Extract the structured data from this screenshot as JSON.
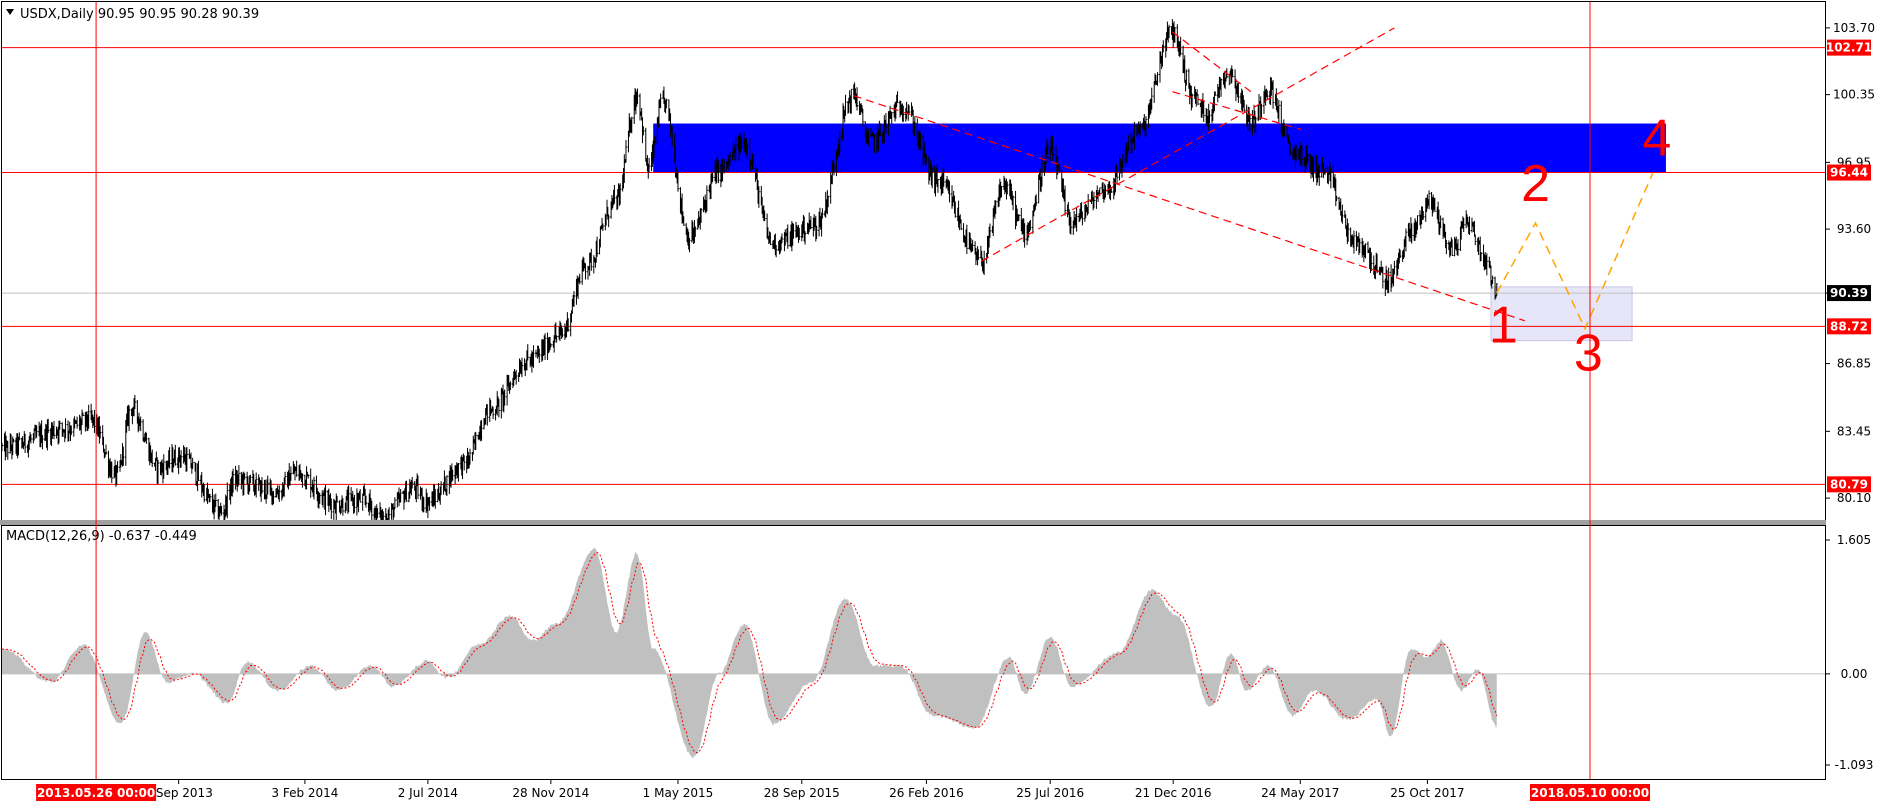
{
  "chart_data": [
    {
      "type": "candlestick",
      "header": "USDX,Daily  90.95 90.95 90.28 90.39",
      "price_axis": {
        "ticks": [
          "103.70",
          "100.35",
          "96.95",
          "93.60",
          "90.39",
          "86.85",
          "83.45",
          "80.10"
        ],
        "ylim": [
          79.0,
          105.0
        ]
      },
      "price_tags": [
        {
          "value": 102.71,
          "label": "102.71",
          "bg": "#ff0000",
          "fg": "#ffffff"
        },
        {
          "value": 96.44,
          "label": "96.44",
          "bg": "#ff0000",
          "fg": "#ffffff"
        },
        {
          "value": 90.39,
          "label": "90.39",
          "bg": "#000000",
          "fg": "#ffffff"
        },
        {
          "value": 88.72,
          "label": "88.72",
          "bg": "#ff0000",
          "fg": "#ffffff"
        },
        {
          "value": 80.79,
          "label": "80.79",
          "bg": "#ff0000",
          "fg": "#ffffff"
        }
      ],
      "horizontal_levels": [
        102.71,
        96.44,
        88.72,
        80.79
      ],
      "current_price": 90.39,
      "resistance_zone": {
        "from": 96.44,
        "to": 98.9,
        "color": "#0000ff"
      },
      "target_zone": {
        "from": 88.0,
        "to": 90.7,
        "color": "#e6e6f8"
      },
      "price_path_anchors": [
        {
          "date": "2013-02-01",
          "value": 82.6
        },
        {
          "date": "2013-04-20",
          "value": 83.6
        },
        {
          "date": "2013-05-20",
          "value": 84.0
        },
        {
          "date": "2013-06-20",
          "value": 81.2
        },
        {
          "date": "2013-07-08",
          "value": 84.6
        },
        {
          "date": "2013-08-10",
          "value": 81.6
        },
        {
          "date": "2013-09-05",
          "value": 82.2
        },
        {
          "date": "2013-10-25",
          "value": 79.4
        },
        {
          "date": "2013-11-10",
          "value": 81.0
        },
        {
          "date": "2014-01-01",
          "value": 80.4
        },
        {
          "date": "2014-01-22",
          "value": 81.4
        },
        {
          "date": "2014-03-12",
          "value": 79.8
        },
        {
          "date": "2014-04-15",
          "value": 80.0
        },
        {
          "date": "2014-05-08",
          "value": 79.1
        },
        {
          "date": "2014-06-15",
          "value": 80.6
        },
        {
          "date": "2014-07-01",
          "value": 79.9
        },
        {
          "date": "2014-08-15",
          "value": 81.8
        },
        {
          "date": "2014-09-15",
          "value": 84.5
        },
        {
          "date": "2014-11-01",
          "value": 87.0
        },
        {
          "date": "2014-12-10",
          "value": 88.3
        },
        {
          "date": "2015-01-10",
          "value": 91.8
        },
        {
          "date": "2015-02-15",
          "value": 95.0
        },
        {
          "date": "2015-03-13",
          "value": 100.3
        },
        {
          "date": "2015-03-26",
          "value": 96.6
        },
        {
          "date": "2015-04-13",
          "value": 100.0
        },
        {
          "date": "2015-05-15",
          "value": 93.2
        },
        {
          "date": "2015-06-20",
          "value": 96.5
        },
        {
          "date": "2015-07-20",
          "value": 97.9
        },
        {
          "date": "2015-08-24",
          "value": 92.9
        },
        {
          "date": "2015-10-15",
          "value": 93.8
        },
        {
          "date": "2015-11-30",
          "value": 100.3
        },
        {
          "date": "2015-12-20",
          "value": 98.0
        },
        {
          "date": "2016-01-28",
          "value": 99.8
        },
        {
          "date": "2016-03-10",
          "value": 96.0
        },
        {
          "date": "2016-05-03",
          "value": 92.0
        },
        {
          "date": "2016-05-30",
          "value": 95.8
        },
        {
          "date": "2016-06-24",
          "value": 93.5
        },
        {
          "date": "2016-07-25",
          "value": 97.5
        },
        {
          "date": "2016-08-20",
          "value": 94.0
        },
        {
          "date": "2016-10-01",
          "value": 95.6
        },
        {
          "date": "2016-11-10",
          "value": 98.5
        },
        {
          "date": "2016-12-20",
          "value": 103.5
        },
        {
          "date": "2017-01-15",
          "value": 100.2
        },
        {
          "date": "2017-01-31",
          "value": 99.4
        },
        {
          "date": "2017-02-25",
          "value": 101.5
        },
        {
          "date": "2017-03-27",
          "value": 99.0
        },
        {
          "date": "2017-04-15",
          "value": 100.7
        },
        {
          "date": "2017-05-15",
          "value": 97.5
        },
        {
          "date": "2017-06-20",
          "value": 96.5
        },
        {
          "date": "2017-08-01",
          "value": 92.8
        },
        {
          "date": "2017-09-08",
          "value": 91.0
        },
        {
          "date": "2017-10-05",
          "value": 93.4
        },
        {
          "date": "2017-10-27",
          "value": 95.0
        },
        {
          "date": "2017-11-25",
          "value": 92.6
        },
        {
          "date": "2017-12-12",
          "value": 94.0
        },
        {
          "date": "2018-01-05",
          "value": 92.0
        },
        {
          "date": "2018-01-17",
          "value": 90.4
        }
      ],
      "projection_path": [
        {
          "date": "2018-01-17",
          "value": 90.4
        },
        {
          "date": "2018-03-05",
          "value": 93.9
        },
        {
          "date": "2018-05-04",
          "value": 88.6
        },
        {
          "date": "2018-07-25",
          "value": 96.4
        }
      ],
      "wave_labels": [
        {
          "label": "1",
          "date": "2018-01-25",
          "value": 87.9
        },
        {
          "label": "2",
          "date": "2018-03-05",
          "value": 95.0
        },
        {
          "label": "3",
          "date": "2018-05-08",
          "value": 86.5
        },
        {
          "label": "4",
          "date": "2018-07-30",
          "value": 97.3
        }
      ],
      "trend_lines": [
        {
          "from": {
            "date": "2016-05-03",
            "value": 92.0
          },
          "to": {
            "date": "2017-09-15",
            "value": 103.7
          }
        },
        {
          "from": {
            "date": "2015-11-30",
            "value": 100.3
          },
          "to": {
            "date": "2018-02-20",
            "value": 89.0
          }
        },
        {
          "from": {
            "date": "2016-12-20",
            "value": 103.5
          },
          "to": {
            "date": "2017-03-25",
            "value": 100.5
          }
        },
        {
          "from": {
            "date": "2016-12-20",
            "value": 100.5
          },
          "to": {
            "date": "2017-05-25",
            "value": 98.6
          }
        }
      ],
      "vertical_markers": [
        {
          "date": "2013-05-26",
          "label": "2013.05.26 00:00"
        },
        {
          "date": "2018-05-10",
          "label": "2018.05.10 00:00"
        }
      ]
    },
    {
      "type": "macd",
      "header": "MACD(12,26,9) -0.637 -0.449",
      "axis": {
        "ticks": [
          "1.605",
          "0.00",
          "-1.093"
        ],
        "ylim": [
          -1.093,
          1.605
        ]
      },
      "histogram_color": "#c0c0c0",
      "signal_color": "#ff0000",
      "value_anchors": [
        {
          "date": "2013-02-01",
          "value": 0.3
        },
        {
          "date": "2013-04-01",
          "value": -0.1
        },
        {
          "date": "2013-05-10",
          "value": 0.35
        },
        {
          "date": "2013-06-25",
          "value": -0.6
        },
        {
          "date": "2013-07-25",
          "value": 0.5
        },
        {
          "date": "2013-08-20",
          "value": -0.1
        },
        {
          "date": "2013-09-20",
          "value": 0.0
        },
        {
          "date": "2013-11-01",
          "value": -0.35
        },
        {
          "date": "2013-11-25",
          "value": 0.15
        },
        {
          "date": "2014-01-01",
          "value": -0.2
        },
        {
          "date": "2014-02-10",
          "value": 0.1
        },
        {
          "date": "2014-03-15",
          "value": -0.2
        },
        {
          "date": "2014-04-25",
          "value": 0.1
        },
        {
          "date": "2014-05-20",
          "value": -0.15
        },
        {
          "date": "2014-07-01",
          "value": 0.15
        },
        {
          "date": "2014-07-25",
          "value": -0.05
        },
        {
          "date": "2014-09-01",
          "value": 0.35
        },
        {
          "date": "2014-10-10",
          "value": 0.7
        },
        {
          "date": "2014-11-05",
          "value": 0.4
        },
        {
          "date": "2014-12-05",
          "value": 0.6
        },
        {
          "date": "2015-01-20",
          "value": 1.5
        },
        {
          "date": "2015-02-15",
          "value": 0.5
        },
        {
          "date": "2015-03-12",
          "value": 1.45
        },
        {
          "date": "2015-04-01",
          "value": 0.3
        },
        {
          "date": "2015-05-20",
          "value": -1.0
        },
        {
          "date": "2015-06-20",
          "value": 0.0
        },
        {
          "date": "2015-07-20",
          "value": 0.6
        },
        {
          "date": "2015-08-25",
          "value": -0.6
        },
        {
          "date": "2015-10-10",
          "value": -0.1
        },
        {
          "date": "2015-11-20",
          "value": 0.9
        },
        {
          "date": "2015-12-25",
          "value": 0.1
        },
        {
          "date": "2016-01-25",
          "value": 0.1
        },
        {
          "date": "2016-03-05",
          "value": -0.5
        },
        {
          "date": "2016-04-25",
          "value": -0.65
        },
        {
          "date": "2016-06-05",
          "value": 0.2
        },
        {
          "date": "2016-06-25",
          "value": -0.25
        },
        {
          "date": "2016-07-25",
          "value": 0.45
        },
        {
          "date": "2016-08-20",
          "value": -0.15
        },
        {
          "date": "2016-10-15",
          "value": 0.25
        },
        {
          "date": "2016-11-25",
          "value": 1.0
        },
        {
          "date": "2016-12-25",
          "value": 0.7
        },
        {
          "date": "2017-02-05",
          "value": -0.4
        },
        {
          "date": "2017-03-01",
          "value": 0.25
        },
        {
          "date": "2017-03-20",
          "value": -0.2
        },
        {
          "date": "2017-04-15",
          "value": 0.1
        },
        {
          "date": "2017-05-15",
          "value": -0.5
        },
        {
          "date": "2017-06-10",
          "value": -0.2
        },
        {
          "date": "2017-07-20",
          "value": -0.55
        },
        {
          "date": "2017-08-25",
          "value": -0.3
        },
        {
          "date": "2017-09-10",
          "value": -0.75
        },
        {
          "date": "2017-10-05",
          "value": 0.3
        },
        {
          "date": "2017-10-25",
          "value": 0.2
        },
        {
          "date": "2017-11-10",
          "value": 0.4
        },
        {
          "date": "2017-12-05",
          "value": -0.2
        },
        {
          "date": "2017-12-25",
          "value": 0.05
        },
        {
          "date": "2018-01-17",
          "value": -0.637
        }
      ]
    }
  ],
  "time_axis": {
    "ticks": [
      {
        "date": "2013-09-03",
        "label": "3 Sep 2013"
      },
      {
        "date": "2014-02-03",
        "label": "3 Feb 2014"
      },
      {
        "date": "2014-07-02",
        "label": "2 Jul 2014"
      },
      {
        "date": "2014-11-28",
        "label": "28 Nov 2014"
      },
      {
        "date": "2015-05-01",
        "label": "1 May 2015"
      },
      {
        "date": "2015-09-28",
        "label": "28 Sep 2015"
      },
      {
        "date": "2016-02-26",
        "label": "26 Feb 2016"
      },
      {
        "date": "2016-07-25",
        "label": "25 Jul 2016"
      },
      {
        "date": "2016-12-21",
        "label": "21 Dec 2016"
      },
      {
        "date": "2017-05-24",
        "label": "24 May 2017"
      },
      {
        "date": "2017-10-25",
        "label": "25 Oct 2017"
      }
    ]
  }
}
